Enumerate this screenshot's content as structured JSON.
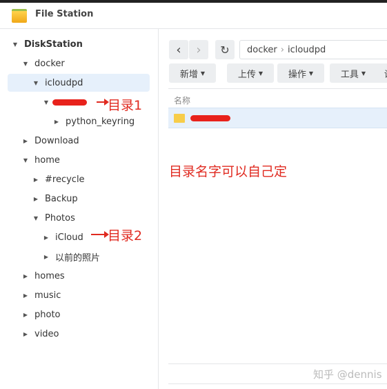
{
  "app": {
    "title": "File Station",
    "icon": "folder-icon"
  },
  "tree": [
    {
      "label": "DiskStation",
      "level": 0,
      "expanded": true,
      "bold": true
    },
    {
      "label": "docker",
      "level": 1,
      "expanded": true
    },
    {
      "label": "icloudpd",
      "level": 2,
      "expanded": true,
      "selected": true
    },
    {
      "label": "",
      "level": 3,
      "expanded": true,
      "redacted": true
    },
    {
      "label": "python_keyring",
      "level": 4,
      "expanded": false
    },
    {
      "label": "Download",
      "level": 1,
      "expanded": false
    },
    {
      "label": "home",
      "level": 1,
      "expanded": true
    },
    {
      "label": "#recycle",
      "level": 2,
      "expanded": false
    },
    {
      "label": "Backup",
      "level": 2,
      "expanded": false
    },
    {
      "label": "Photos",
      "level": 2,
      "expanded": true
    },
    {
      "label": "iCloud",
      "level": 3,
      "expanded": false
    },
    {
      "label": "以前的照片",
      "level": 3,
      "expanded": false
    },
    {
      "label": "homes",
      "level": 1,
      "expanded": false
    },
    {
      "label": "music",
      "level": 1,
      "expanded": false
    },
    {
      "label": "photo",
      "level": 1,
      "expanded": false
    },
    {
      "label": "video",
      "level": 1,
      "expanded": false
    }
  ],
  "annotations": {
    "dir1": "目录1",
    "dir2": "目录2",
    "note": "目录名字可以自己定",
    "color": "#e02a20"
  },
  "nav": {
    "back": "‹",
    "forward": "›",
    "refresh": "↻",
    "path": [
      "docker",
      "icloudpd"
    ]
  },
  "toolbar": [
    "新增",
    "上传",
    "操作",
    "工具",
    "设置"
  ],
  "list": {
    "column_name": "名称"
  },
  "watermark": "知乎 @dennis"
}
